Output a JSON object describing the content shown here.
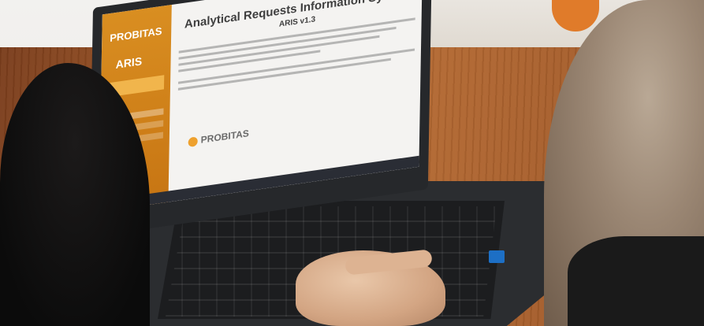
{
  "scene": {
    "description_visible_text": {
      "screen_title": "Analytical Requests Information System",
      "screen_subtitle": "ARIS v1.3",
      "sidebar_brand": "PROBITAS",
      "sidebar_app": "ARIS",
      "footer_logo": "PROBITAS"
    }
  },
  "colors": {
    "sidebar": "#d98e21",
    "screen_bg": "#f4f3f1",
    "table": "#a45c2a"
  }
}
